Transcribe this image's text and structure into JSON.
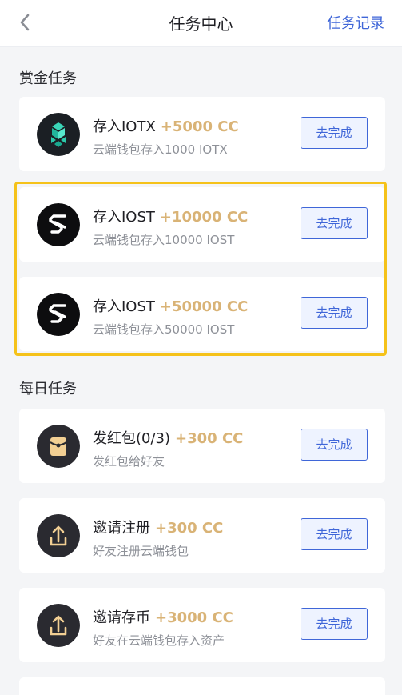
{
  "header": {
    "title": "任务中心",
    "record_label": "任务记录"
  },
  "sections": {
    "bounty": "赏金任务",
    "daily": "每日任务"
  },
  "bounty_tasks": [
    {
      "name": "存入IOTX",
      "reward": "+5000 CC",
      "desc": "云端钱包存入1000 IOTX",
      "button": "去完成",
      "icon": "iotx-logo-icon"
    },
    {
      "name": "存入IOST",
      "reward": "+10000 CC",
      "desc": "云端钱包存入10000 IOST",
      "button": "去完成",
      "icon": "iost-logo-icon"
    },
    {
      "name": "存入IOST",
      "reward": "+50000 CC",
      "desc": "云端钱包存入50000 IOST",
      "button": "去完成",
      "icon": "iost-logo-icon"
    }
  ],
  "daily_tasks": [
    {
      "name": "发红包(0/3)",
      "reward": "+300 CC",
      "desc": "发红包给好友",
      "button": "去完成",
      "icon": "red-envelope-icon"
    },
    {
      "name": "邀请注册",
      "reward": "+300 CC",
      "desc": "好友注册云端钱包",
      "button": "去完成",
      "icon": "share-upload-icon"
    },
    {
      "name": "邀请存币",
      "reward": "+3000 CC",
      "desc": "好友在云端钱包存入资产",
      "button": "去完成",
      "icon": "share-upload-icon"
    }
  ],
  "colors": {
    "accent": "#3f66d8",
    "reward": "#d9b376",
    "highlight": "#f5c21a"
  }
}
